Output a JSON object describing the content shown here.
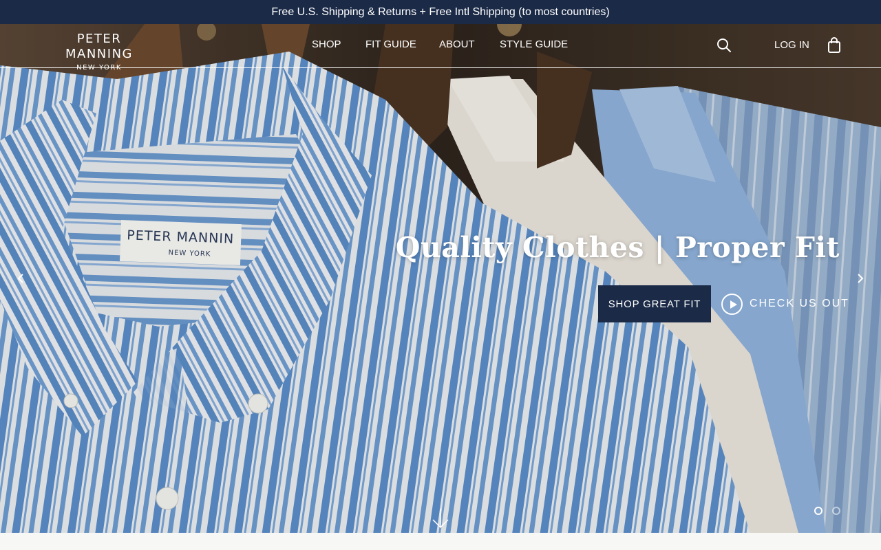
{
  "announcement": "Free U.S. Shipping & Returns + Free Intl Shipping (to most countries)",
  "logo": {
    "line1": "PETER MANNING",
    "line2": "NEW YORK"
  },
  "nav": [
    {
      "label": "SHOP"
    },
    {
      "label": "FIT GUIDE"
    },
    {
      "label": "ABOUT"
    },
    {
      "label": "STYLE GUIDE"
    }
  ],
  "header_actions": {
    "search_icon": "search-icon",
    "login_label": "LOG IN",
    "bag_icon": "shopping-bag-icon"
  },
  "hero": {
    "headline": "Quality Clothes | Proper Fit",
    "primary_cta": "SHOP GREAT FIT",
    "secondary_cta": "CHECK US OUT",
    "label_brand": "PETER MANNIN",
    "label_city": "NEW YORK",
    "slides_total": 2,
    "active_slide": 1
  },
  "colors": {
    "navy": "#1b2a47",
    "white": "#ffffff"
  }
}
